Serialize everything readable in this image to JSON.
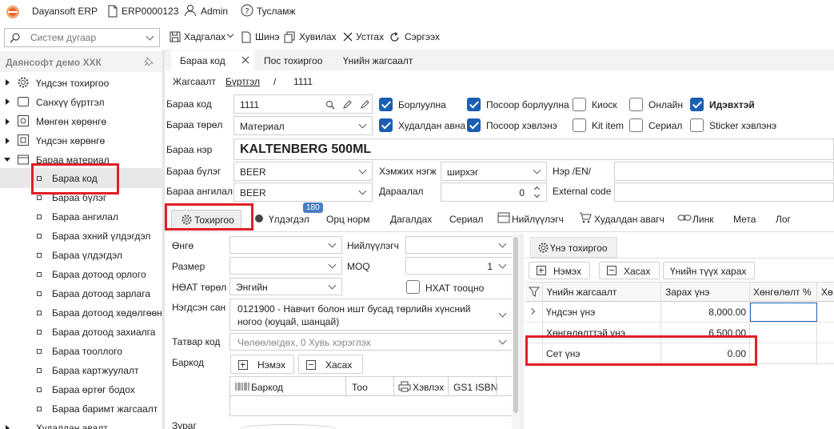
{
  "app": {
    "title": "Dayansoft ERP",
    "doc": "ERP0000123",
    "user": "Admin",
    "help": "Тусламж"
  },
  "toolbar": {
    "search_placeholder": "Систем дугаар",
    "save": "Хадгалах",
    "new": "Шинэ",
    "copy": "Хувилах",
    "delete": "Устгах",
    "refresh": "Сэргээх"
  },
  "sidebar": {
    "company": "Даянсофт демо ХХК",
    "items": [
      "Үндсэн тохиргоо",
      "Санхүү бүртгэл",
      "Мөнгөн хөрөнгө",
      "Үндсэн хөрөнгө",
      "Бараа материал"
    ],
    "sub": [
      "Бараа код",
      "Бараа бүлэг",
      "Бараа ангилал",
      "Бараа эхний үлдэгдэл",
      "Бараа үлдэгдэл",
      "Бараа дотоод орлого",
      "Бараа дотоод зарлага",
      "Бараа дотоод хөдөлгөөн",
      "Бараа дотоод захиалга",
      "Бараа тооллого",
      "Бараа картжуулалт",
      "Бараа өртөг бодох",
      "Бараа баримт жагсаалт"
    ],
    "bottom": "Худалдан авалт"
  },
  "tabs": [
    "Бараа код",
    "Пос тохиргоо",
    "Үнийн жагсаалт"
  ],
  "crumb": {
    "list": "Жагсаалт",
    "register": "Бүртгэл",
    "sep": "/",
    "code": "1111"
  },
  "form": {
    "code_label": "Бараа код",
    "code": "1111",
    "type_label": "Бараа төрөл",
    "type": "Материал",
    "name_label": "Бараа нэр",
    "name": "KALTENBERG 500ML",
    "group_label": "Бараа бүлэг",
    "group": "BEER",
    "class_label": "Бараа ангилал",
    "class": "BEER",
    "unit_label": "Хэмжих нэгж",
    "unit": "ширхэг",
    "order_label": "Дараалал",
    "order": "0",
    "en_label": "Нэр /EN/",
    "ext_label": "External code"
  },
  "checks": [
    {
      "label": "Борлуулна",
      "on": true
    },
    {
      "label": "Посоор борлуулна",
      "on": true
    },
    {
      "label": "Киоск",
      "on": false
    },
    {
      "label": "Онлайн",
      "on": false
    },
    {
      "label": "Идэвхтэй",
      "on": true
    },
    {
      "label": "Худалдан авна",
      "on": true
    },
    {
      "label": "Посоор хэвлэнэ",
      "on": true
    },
    {
      "label": "Kit item",
      "on": false
    },
    {
      "label": "Сериал",
      "on": false
    },
    {
      "label": "Sticker хэвлэнэ",
      "on": false
    }
  ],
  "subtabs": {
    "settings": "Тохиргоо",
    "balance": "Үлдэгдэл",
    "badge": "180",
    "ingredients": "Орц норм",
    "extras": "Дагалдах",
    "serial": "Сериал",
    "supplier": "Нийлүүлэгч",
    "purchase": "Худалдан авагч",
    "link": "Линк",
    "meta": "Мета",
    "log": "Лог"
  },
  "left": {
    "color": "Өнгө",
    "size": "Размер",
    "vat_type": "НӨАТ төрөл",
    "vat_type_val": "Энгийн",
    "unit_code": "Нэгдсэн сан",
    "unit_code_val": "0121900 - Навчит болон ишт бусад төрлийн хүнсний ногоо (юуцай, шанцай)",
    "tax_code": "Татвар код",
    "tax_code_ph": "Чөлөөлөгдөх, 0 Хувь хэрэглэх",
    "barcode": "Баркод",
    "add": "Нэмэх",
    "remove": "Хасах",
    "col_barcode": "Баркод",
    "col_qty": "Тоо",
    "col_print": "Хэвлэх",
    "col_gs1": "GS1 ISBN",
    "image": "Зураг",
    "supplier": "Нийлүүлэгч",
    "moq": "MOQ",
    "moq_val": "1",
    "vat_calc": "НХАТ тооцно"
  },
  "price": {
    "tab": "Үнэ тохиргоо",
    "add": "Нэмэх",
    "remove": "Хасах",
    "history": "Үнийн түүх харах",
    "headers": [
      "Үнийн жагсаалт",
      "Зарах үнэ",
      "Хөнгөлөлт %",
      "Хө"
    ],
    "rows": [
      {
        "name": "Үндсэн үнэ",
        "value": "8,000.00"
      },
      {
        "name": "Хөнгөлөлттэй үнэ",
        "value": "6,500.00"
      },
      {
        "name": "Сет үнэ",
        "value": "0.00"
      }
    ]
  },
  "colors": {
    "accent": "#1a5fb4",
    "highlight": "#e01f26",
    "brand": "#e8662c"
  }
}
